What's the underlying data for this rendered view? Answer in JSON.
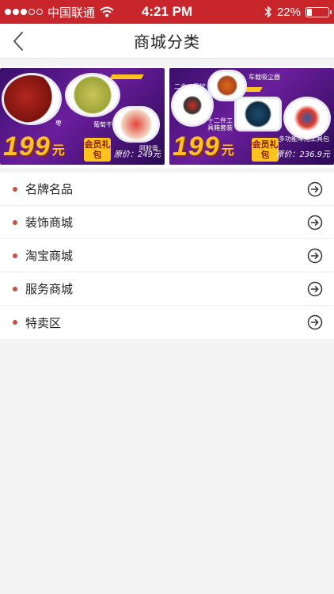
{
  "status_bar": {
    "carrier": "中国联通",
    "time": "4:21 PM",
    "battery": "22%",
    "battery_level": 0.22,
    "signal_dots": 5,
    "signal_filled": 3
  },
  "nav": {
    "title": "商城分类",
    "back_icon": "chevron-left-icon"
  },
  "banners": [
    {
      "price": "199",
      "currency": "元",
      "badge": "会员礼包",
      "original_price": "原价：249元",
      "tags": [
        "枣",
        "葡萄干",
        "阿胶膏"
      ]
    },
    {
      "price": "199",
      "currency": "元",
      "badge": "会员礼包",
      "original_price": "原价：236.9元",
      "tags": [
        "二合一雪铲",
        "车载吸尘器",
        "十二件工具箱套装",
        "多功能车用工具包"
      ]
    }
  ],
  "categories": [
    {
      "label": "名牌名品"
    },
    {
      "label": "装饰商城"
    },
    {
      "label": "淘宝商城"
    },
    {
      "label": "服务商城"
    },
    {
      "label": "特卖区"
    }
  ],
  "colors": {
    "status_bar": "#c8262b",
    "dot": "#c25245",
    "banner_gold": "#ffc21e",
    "banner_purple": "#4a167a"
  }
}
